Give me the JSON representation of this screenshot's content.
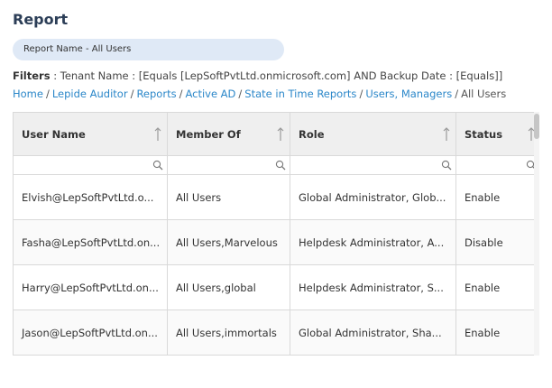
{
  "page": {
    "title": "Report",
    "report_name": "Report Name - All Users"
  },
  "filters": {
    "label": "Filters",
    "text": " : Tenant Name : [Equals [LepSoftPvtLtd.onmicrosoft.com] AND Backup Date : [Equals]]"
  },
  "breadcrumb": {
    "items": [
      "Home",
      "Lepide Auditor",
      "Reports",
      "Active AD",
      "State in Time Reports",
      "Users, Managers"
    ],
    "current": "All Users",
    "separator": "/"
  },
  "table": {
    "columns": [
      "User Name",
      "Member Of",
      "Role",
      "Status"
    ],
    "filter_placeholders": [
      "",
      "",
      "",
      ""
    ],
    "rows": [
      [
        "Elvish@LepSoftPvtLtd.o...",
        "All Users",
        "Global Administrator, Glob...",
        "Enable"
      ],
      [
        "Fasha@LepSoftPvtLtd.on...",
        "All Users,Marvelous",
        "Helpdesk Administrator, A...",
        "Disable"
      ],
      [
        "Harry@LepSoftPvtLtd.on...",
        "All Users,global",
        "Helpdesk Administrator, S...",
        "Enable"
      ],
      [
        "Jason@LepSoftPvtLtd.on...",
        "All Users,immortals",
        "Global Administrator, Sha...",
        "Enable"
      ]
    ]
  },
  "icons": {
    "sort": "sort-arrow-up-icon",
    "filter": "search-icon"
  },
  "colors": {
    "title": "#2c3e57",
    "link": "#2b87c9",
    "pill": "#dfe9f6",
    "header_bg": "#efefef"
  }
}
